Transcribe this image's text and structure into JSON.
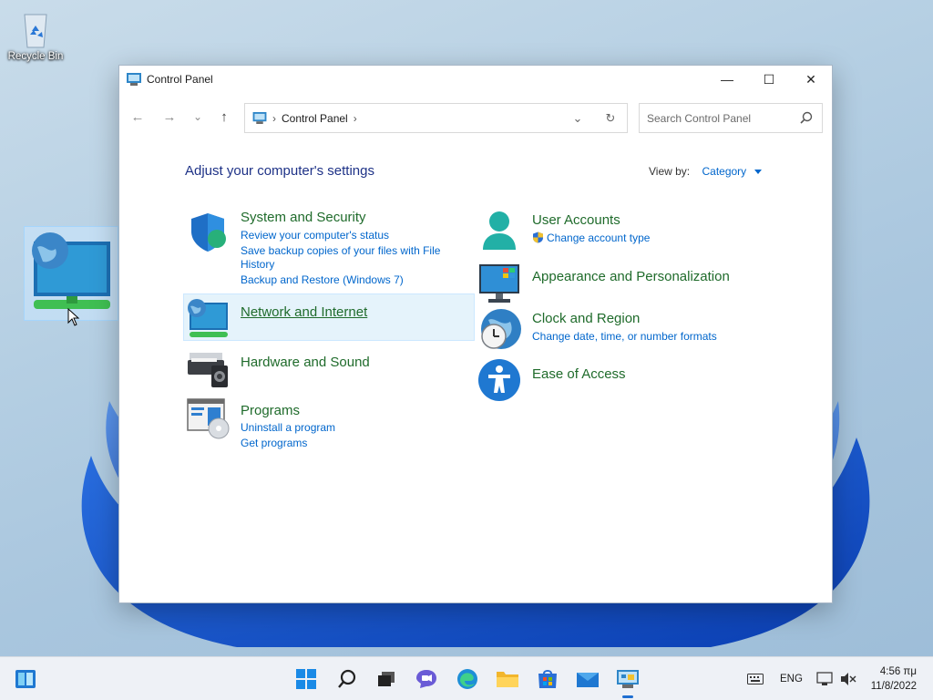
{
  "desktop": {
    "recycle_bin_label": "Recycle Bin"
  },
  "window": {
    "title": "Control Panel",
    "controls": {
      "minimize": "—",
      "maximize": "☐",
      "close": "✕"
    }
  },
  "nav": {
    "back": "←",
    "forward": "→",
    "recent": "⌄",
    "up": "↑"
  },
  "address": {
    "crumb": "Control Panel",
    "separator": "›"
  },
  "search": {
    "placeholder": "Search Control Panel"
  },
  "content": {
    "heading": "Adjust your computer's settings",
    "view_by_label": "View by:",
    "view_by_value": "Category"
  },
  "categories": {
    "system_security": {
      "title": "System and Security",
      "links": [
        "Review your computer's status",
        "Save backup copies of your files with File",
        "History",
        "Backup and Restore (Windows 7)"
      ]
    },
    "network": {
      "title": "Network and Internet"
    },
    "hardware": {
      "title": "Hardware and Sound"
    },
    "programs": {
      "title": "Programs",
      "links": [
        "Uninstall a program",
        "Get programs"
      ]
    },
    "user_accounts": {
      "title": "User Accounts",
      "links": [
        "Change account type"
      ]
    },
    "appearance": {
      "title": "Appearance and Personalization"
    },
    "clock_region": {
      "title": "Clock and Region",
      "links": [
        "Change date, time, or number formats"
      ]
    },
    "ease_access": {
      "title": "Ease of Access"
    }
  },
  "taskbar": {
    "language": "ENG",
    "time": "4:56 πμ",
    "date": "11/8/2022",
    "active_app": "control-panel-icon"
  },
  "colors": {
    "link": "#0066cc",
    "category_title": "#1f6b2b",
    "heading": "#1e3287",
    "accent": "#1f6fd1"
  }
}
